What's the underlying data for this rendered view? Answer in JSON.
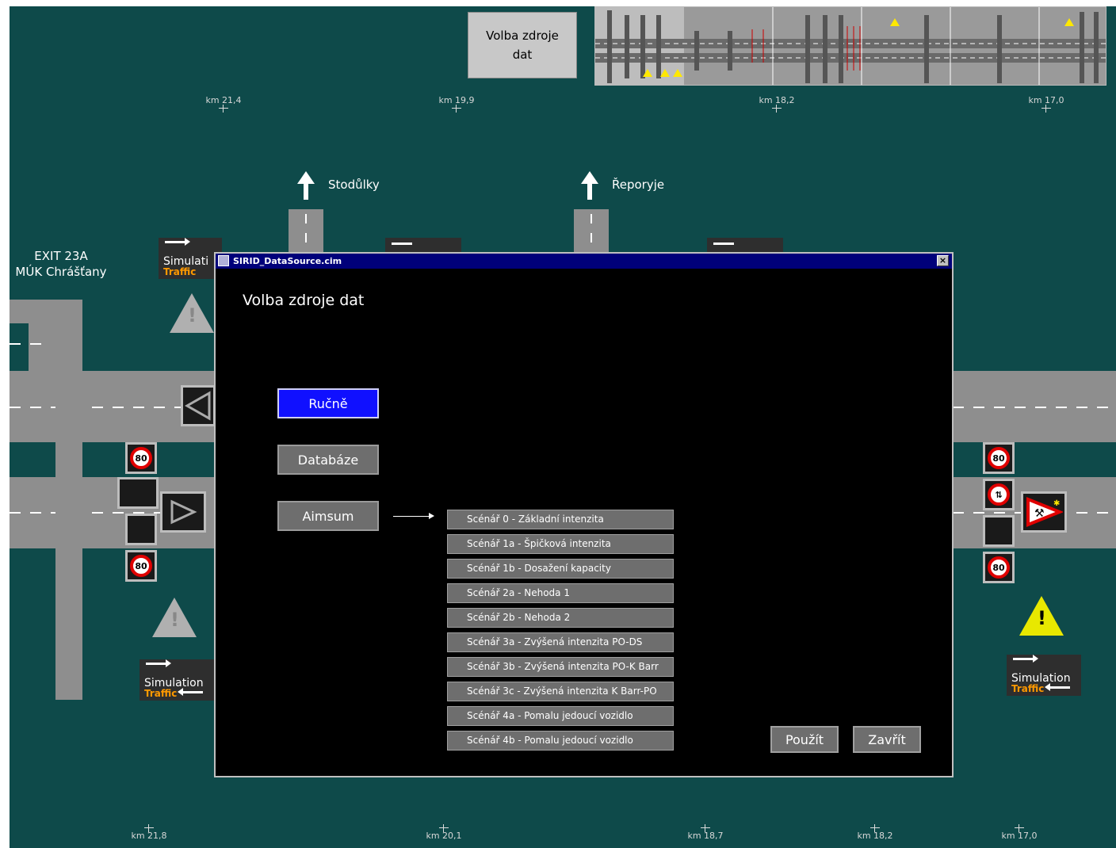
{
  "top_button": {
    "line1": "Volba zdroje",
    "line2": "dat"
  },
  "km_top": [
    "km 21,4",
    "km 19,9",
    "km 18,2",
    "km 17,0"
  ],
  "km_bottom": [
    "km 21,8",
    "km 20,1",
    "km 18,7",
    "km 18,2",
    "km 17,0"
  ],
  "directions": [
    "Stodůlky",
    "Řeporyje"
  ],
  "exit": {
    "line1": "EXIT 23A",
    "line2": "MÚK Chrášťany"
  },
  "sim_labels": {
    "simulation": "Simulation",
    "traffic": "Traffic"
  },
  "sim_label_cut": "Simulati",
  "speed_limit": "80",
  "colors": {
    "background": "#0e4a4a",
    "dialog_title": "#00007a",
    "active_button": "#1010ff",
    "warning_yellow": "#e8e800"
  },
  "dialog": {
    "title": "SIRID_DataSource.cim",
    "close": "×",
    "heading": "Volba zdroje dat",
    "mode_buttons": [
      {
        "label": "Ručně",
        "active": true
      },
      {
        "label": "Databáze",
        "active": false
      },
      {
        "label": "Aimsum",
        "active": false
      }
    ],
    "scenarios": [
      "Scénář 0 - Základní intenzita",
      "Scénář 1a - Špičková intenzita",
      "Scénář 1b - Dosažení kapacity",
      "Scénář 2a - Nehoda 1",
      "Scénář 2b - Nehoda 2",
      "Scénář 3a - Zvýšená intenzita PO-DS",
      "Scénář 3b - Zvýšená intenzita PO-K Barr",
      "Scénář 3c - Zvýšená intenzita K Barr-PO",
      "Scénář 4a - Pomalu jedoucí vozidlo",
      "Scénář 4b - Pomalu jedoucí vozidlo"
    ],
    "apply": "Použít",
    "close_button": "Zavřít"
  }
}
